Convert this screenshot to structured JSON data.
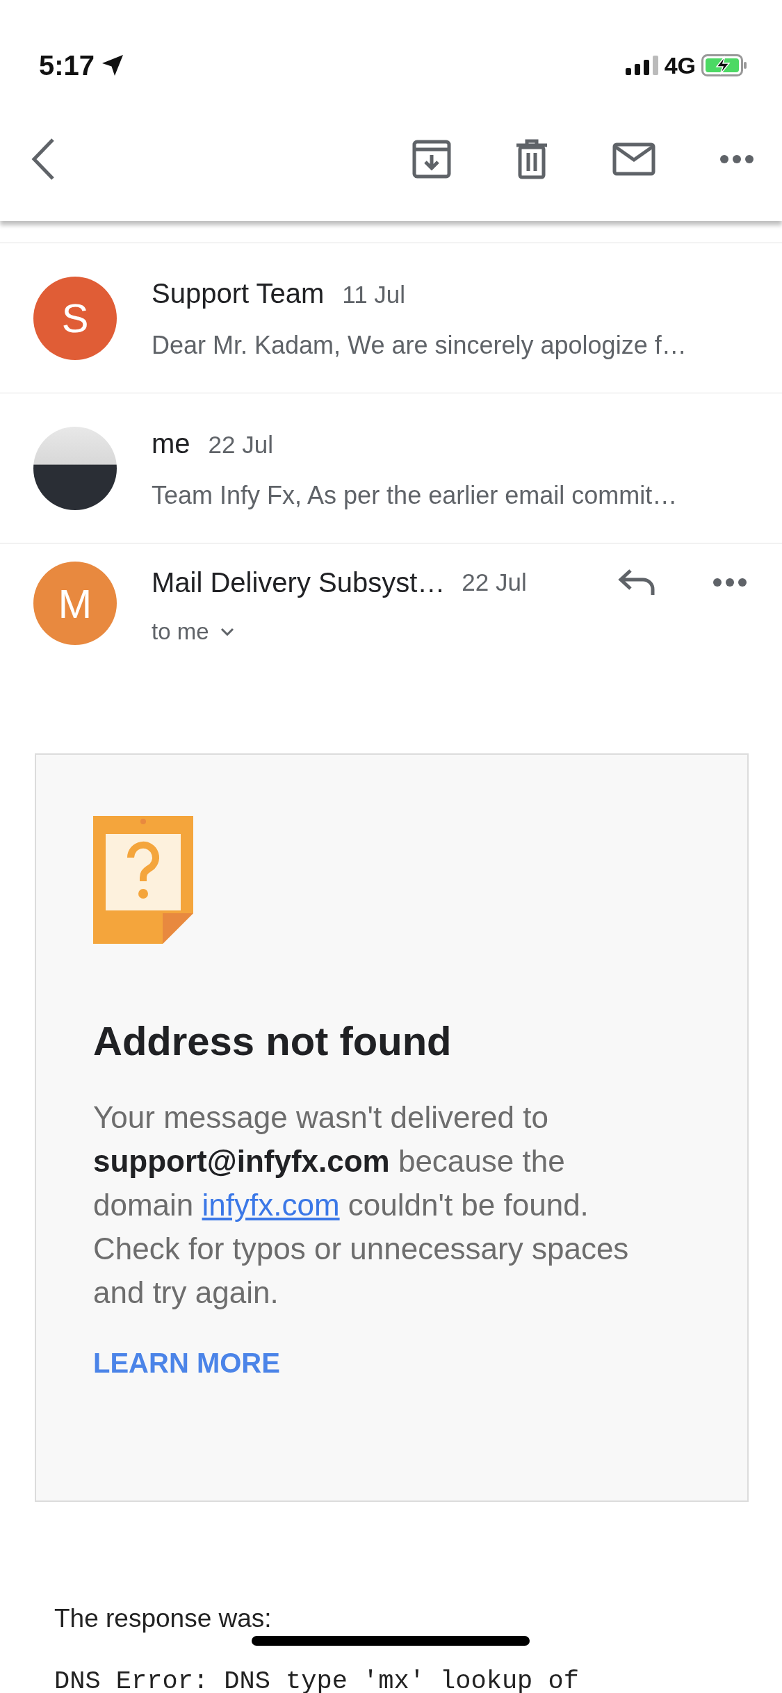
{
  "status_bar": {
    "time": "5:17",
    "network": "4G"
  },
  "threads": [
    {
      "kind": "letter",
      "avatar": "S",
      "color": "#e05d36",
      "sender": "Support Team",
      "date": "11 Jul",
      "snippet": "Dear Mr. Kadam, We are sincerely apologize f…"
    },
    {
      "kind": "photo",
      "sender": "me",
      "date": "22 Jul",
      "snippet": "Team Infy Fx, As per the earlier email commit…"
    }
  ],
  "message": {
    "avatar": "M",
    "color": "#e8893f",
    "sender": "Mail Delivery Subsyst…",
    "date": "22 Jul",
    "recipients": "to me"
  },
  "bounce_card": {
    "heading": "Address not found",
    "body_before": "Your message wasn't delivered to **support@infyfx.com** because the domain",
    "link": "infyfx.com",
    "body_after": "couldn't be found. Check for typos or unnecessary spaces and try again.",
    "action": "LEARN MORE"
  },
  "response_label": "The response was:",
  "response_text": "DNS Error: DNS type 'mx' lookup of"
}
